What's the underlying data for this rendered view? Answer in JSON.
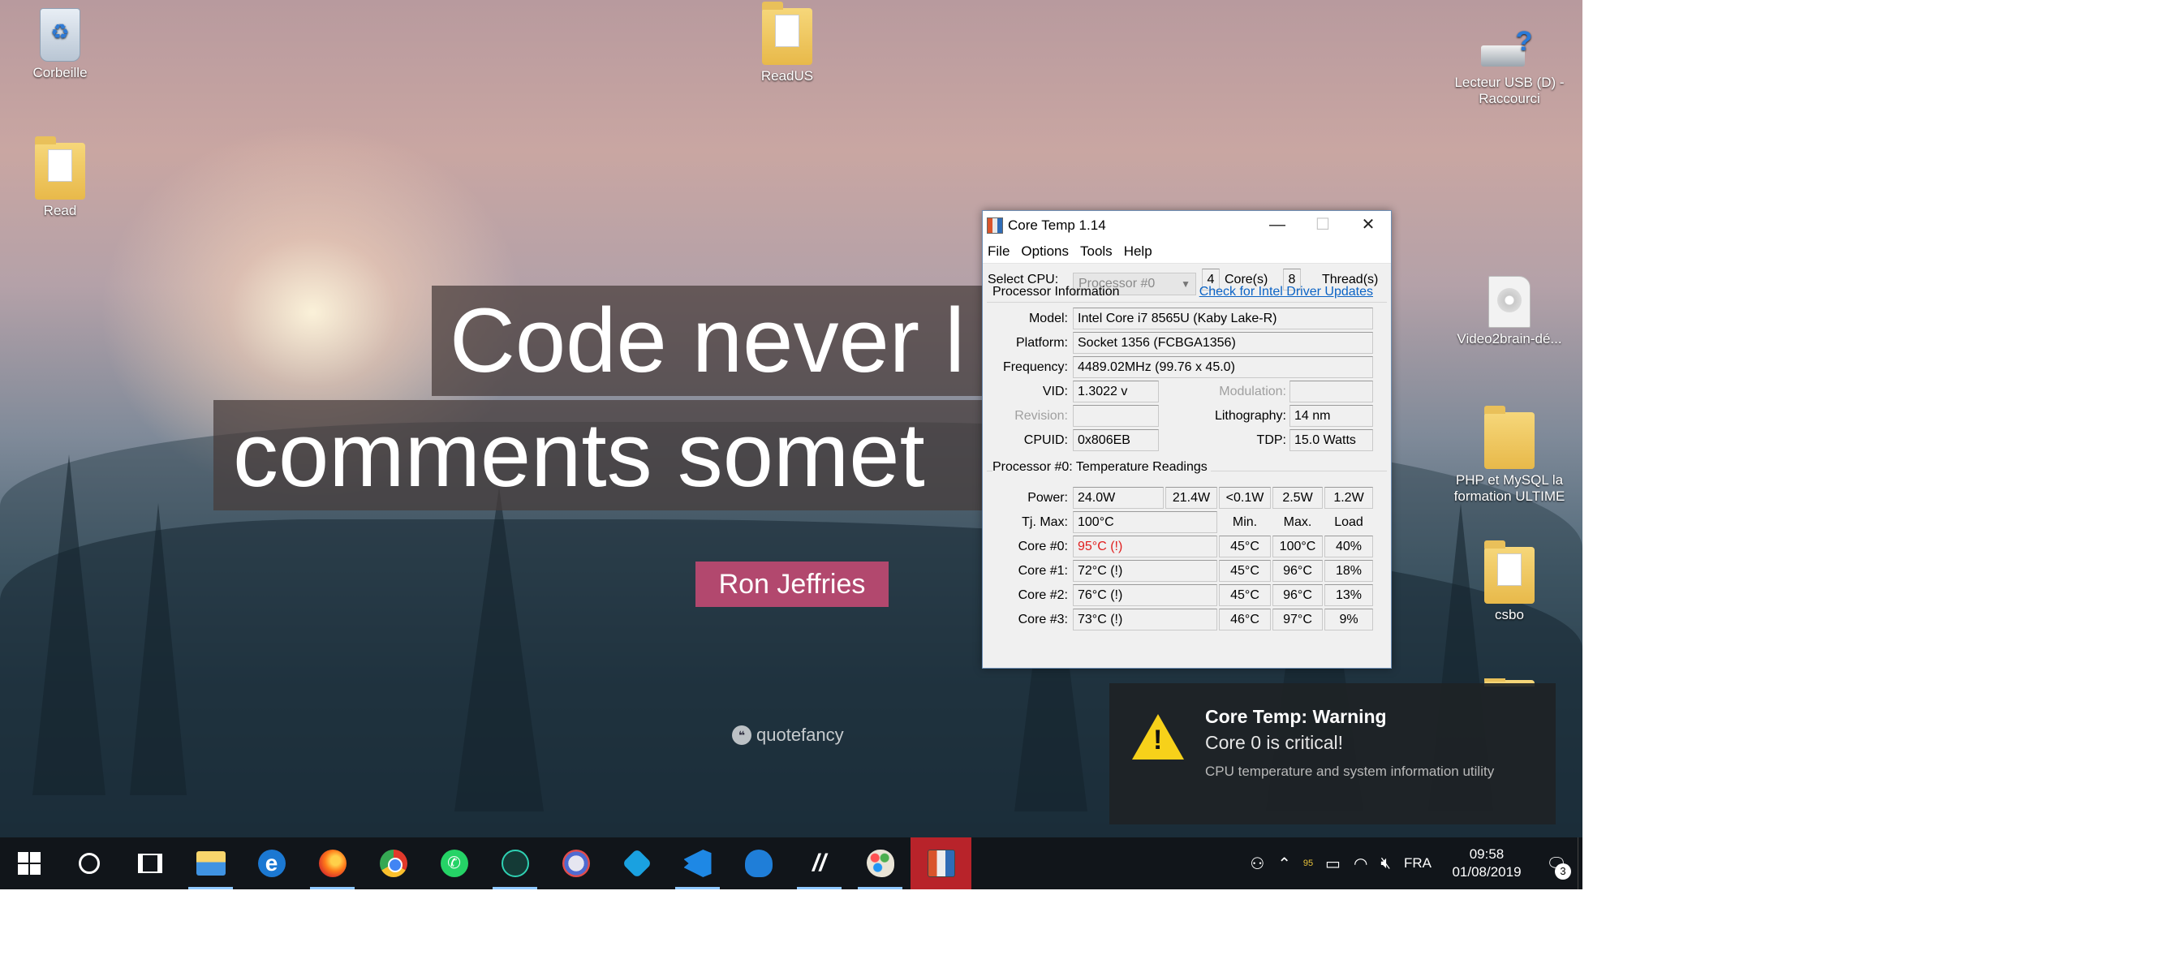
{
  "desktop": {
    "icons": {
      "recycle_bin": "Corbeille",
      "readus": "ReadUS",
      "read": "Read",
      "usb_drive": "Lecteur USB (D) - Raccourci",
      "video2brain": "Video2brain-dé...",
      "php_mysql": "PHP et MySQL  la formation ULTIME",
      "csbo": "csbo"
    },
    "wallpaper": {
      "quote_line_1": "Code never l",
      "quote_line_2": "comments somet",
      "author": "Ron Jeffries",
      "watermark": "quotefancy"
    }
  },
  "coretemp": {
    "title": "Core Temp 1.14",
    "menu": [
      "File",
      "Options",
      "Tools",
      "Help"
    ],
    "select_cpu_label": "Select CPU:",
    "select_cpu_value": "Processor #0",
    "cores_value": "4",
    "cores_label": "Core(s)",
    "threads_value": "8",
    "threads_label": "Thread(s)",
    "processor_info_title": "Processor Information",
    "driver_link": "Check for Intel Driver Updates",
    "model_label": "Model:",
    "model_value": "Intel Core i7 8565U (Kaby Lake-R)",
    "platform_label": "Platform:",
    "platform_value": "Socket 1356 (FCBGA1356)",
    "frequency_label": "Frequency:",
    "frequency_value": "4489.02MHz (99.76 x 45.0)",
    "vid_label": "VID:",
    "vid_value": "1.3022 v",
    "modulation_label": "Modulation:",
    "modulation_value": "",
    "revision_label": "Revision:",
    "revision_value": "",
    "lithography_label": "Lithography:",
    "lithography_value": "14 nm",
    "cpuid_label": "CPUID:",
    "cpuid_value": "0x806EB",
    "tdp_label": "TDP:",
    "tdp_value": "15.0 Watts",
    "temp_title": "Processor #0: Temperature Readings",
    "power_label": "Power:",
    "power_values": [
      "24.0W",
      "21.4W",
      "<0.1W",
      "2.5W",
      "1.2W"
    ],
    "tjmax_label": "Tj. Max:",
    "tjmax_value": "100°C",
    "col_min": "Min.",
    "col_max": "Max.",
    "col_load": "Load",
    "cores": [
      {
        "label": "Core #0:",
        "temp": "95°C (!)",
        "min": "45°C",
        "max": "100°C",
        "load": "40%",
        "critical": true
      },
      {
        "label": "Core #1:",
        "temp": "72°C (!)",
        "min": "45°C",
        "max": "96°C",
        "load": "18%",
        "critical": false
      },
      {
        "label": "Core #2:",
        "temp": "76°C (!)",
        "min": "45°C",
        "max": "96°C",
        "load": "13%",
        "critical": false
      },
      {
        "label": "Core #3:",
        "temp": "73°C (!)",
        "min": "46°C",
        "max": "97°C",
        "load": "9%",
        "critical": false
      }
    ]
  },
  "notification": {
    "title": "Core Temp: Warning",
    "message": "Core 0 is critical!",
    "app_description": "CPU temperature and system information utility"
  },
  "taskbar": {
    "apps": [
      "start",
      "cortana",
      "task-view",
      "file-explorer",
      "edge",
      "firefox",
      "chrome",
      "whatsapp",
      "gitkraken",
      "paint-3d",
      "powershell",
      "vscode",
      "tableplus",
      "arch",
      "paint-palette",
      "core-temp"
    ],
    "tray": {
      "temp_reading": "95",
      "language": "FRA",
      "time": "09:58",
      "date": "01/08/2019",
      "notification_count": "3"
    }
  },
  "colors": {
    "critical_temp": "#e02020",
    "link": "#0b63c5",
    "warning_yellow": "#f7d11a",
    "author_badge": "#b2486e",
    "active_taskbar": "#b8232a"
  }
}
